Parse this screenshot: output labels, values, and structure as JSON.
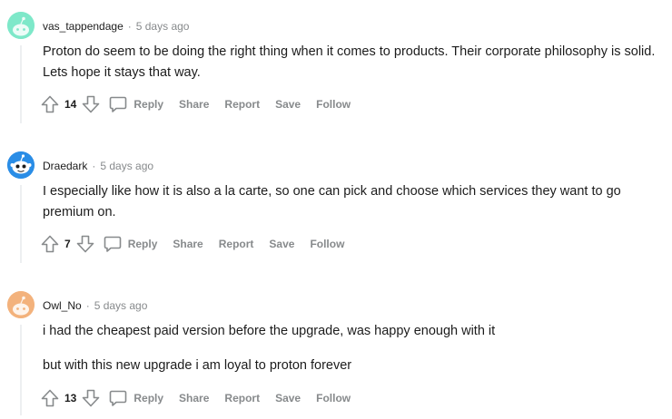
{
  "comments": [
    {
      "author": "vas_tappendage",
      "separator": "·",
      "time": "5 days ago",
      "paragraphs": [
        "Proton do seem to be doing the right thing when it comes to products. Their corporate philosophy is solid. Lets hope it stays that way."
      ],
      "score": "14",
      "avatar_color": "#7ee8c9"
    },
    {
      "author": "Draedark",
      "separator": "·",
      "time": "5 days ago",
      "paragraphs": [
        "I especially like how it is also a la carte, so one can pick and choose which services they want to go premium on."
      ],
      "score": "7",
      "avatar_color": "#2a8de6"
    },
    {
      "author": "Owl_No",
      "separator": "·",
      "time": "5 days ago",
      "paragraphs": [
        "i had the cheapest paid version before the upgrade, was happy enough with it",
        "but with this new upgrade i am loyal to proton forever"
      ],
      "score": "13",
      "avatar_color": "#f3b27c"
    }
  ],
  "actions": {
    "reply": "Reply",
    "share": "Share",
    "report": "Report",
    "save": "Save",
    "follow": "Follow"
  },
  "icons": {
    "upvote": "upvote-arrow-icon",
    "downvote": "downvote-arrow-icon",
    "reply": "speech-bubble-icon"
  },
  "colors": {
    "meta_gray": "#878a8c",
    "thread_line": "#edeff1",
    "text": "#1c1c1c"
  }
}
